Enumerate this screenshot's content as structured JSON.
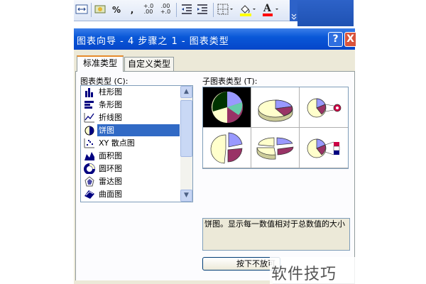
{
  "toolbar": {
    "percent": "%",
    "comma": ",",
    "inc_decimal": "+.0\n.00",
    "dec_decimal": ".00\n+.0",
    "font_color_letter": "A",
    "colors": {
      "fill": "#ffff00",
      "font": "#ff0000"
    }
  },
  "dialog": {
    "title": "图表向导 - 4 步骤之 1 - 图表类型",
    "help": "?",
    "close": "X"
  },
  "tabs": {
    "standard": "标准类型",
    "custom": "自定义类型"
  },
  "chart_type_label": "图表类型 (C):",
  "chart_types": [
    {
      "label": "柱形图",
      "icon": "column-chart-icon"
    },
    {
      "label": "条形图",
      "icon": "bar-chart-icon"
    },
    {
      "label": "折线图",
      "icon": "line-chart-icon"
    },
    {
      "label": "饼图",
      "icon": "pie-chart-icon",
      "selected": true
    },
    {
      "label": "XY 散点图",
      "icon": "scatter-chart-icon"
    },
    {
      "label": "面积图",
      "icon": "area-chart-icon"
    },
    {
      "label": "圆环图",
      "icon": "doughnut-chart-icon"
    },
    {
      "label": "雷达图",
      "icon": "radar-chart-icon"
    },
    {
      "label": "曲面图",
      "icon": "surface-chart-icon"
    }
  ],
  "subtype_label": "子图表类型 (T):",
  "description": "饼图。显示每一数值相对于总数值的大小",
  "press_button": "按下不放可",
  "watermark": "软件技巧"
}
